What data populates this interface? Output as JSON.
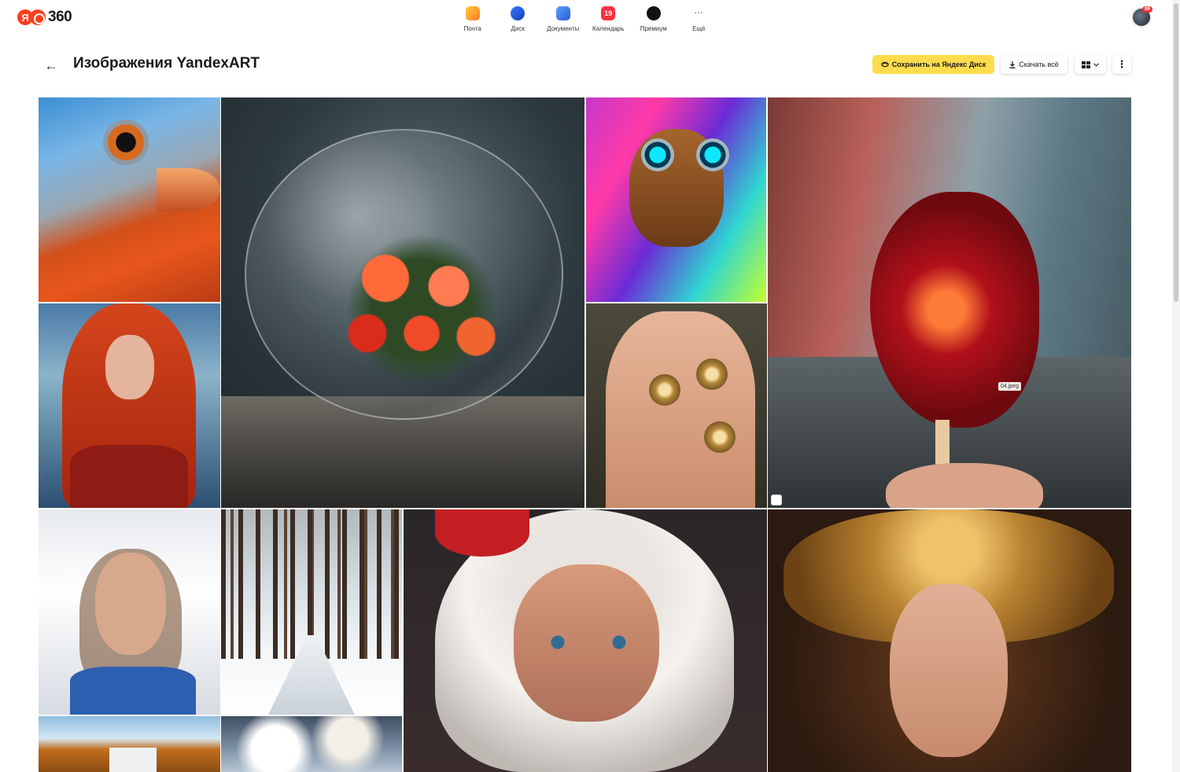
{
  "logo": {
    "badge_text": "Я",
    "number": "360"
  },
  "services": [
    {
      "label": "Почта",
      "icon": "mail-icon"
    },
    {
      "label": "Диск",
      "icon": "disk-icon"
    },
    {
      "label": "Документы",
      "icon": "docs-icon"
    },
    {
      "label": "Календарь",
      "icon": "calendar-icon",
      "badge": "19"
    },
    {
      "label": "Премиум",
      "icon": "premium-icon"
    },
    {
      "label": "Ещё",
      "icon": "more-icon",
      "glyph": "···"
    }
  ],
  "user": {
    "notification_count": "99"
  },
  "header": {
    "back_glyph": "←",
    "title": "Изображения YandexART",
    "save_label": "Сохранить на Яндекс Диск",
    "download_label": "Скачать всё",
    "more_glyph": "⋮"
  },
  "gallery": {
    "file_tag": "04.jpeg"
  },
  "colors": {
    "accent_yellow": "#ffdc4d",
    "brand_red": "#fc3f1d"
  }
}
